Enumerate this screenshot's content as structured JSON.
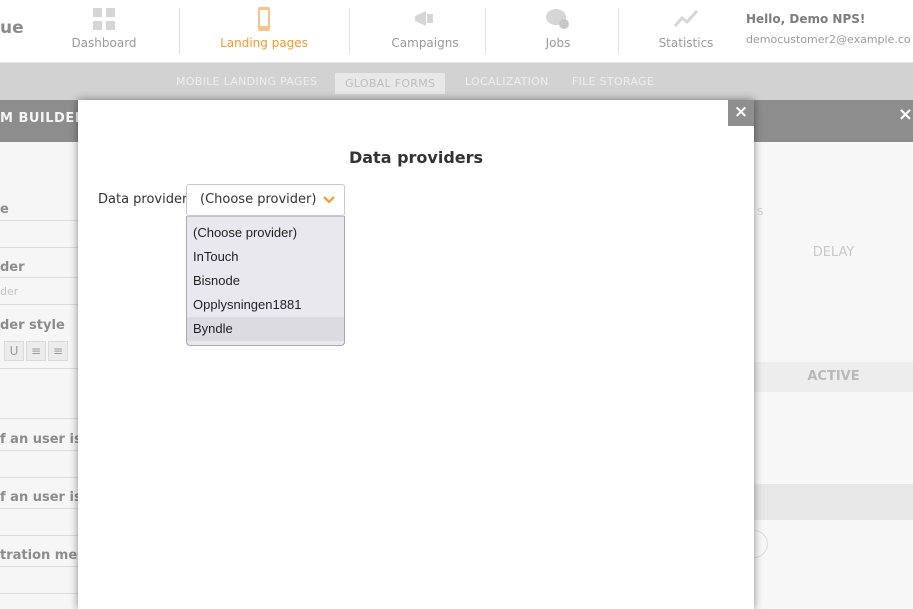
{
  "app": {
    "brand_fragment": "ue",
    "nav": [
      {
        "label": "Dashboard",
        "icon": "grid-icon"
      },
      {
        "label": "Landing pages",
        "icon": "mobile-icon",
        "active": true
      },
      {
        "label": "Campaigns",
        "icon": "megaphone-icon"
      },
      {
        "label": "Jobs",
        "icon": "chat-gear-icon"
      },
      {
        "label": "Statistics",
        "icon": "line-chart-icon"
      }
    ],
    "user": {
      "greeting": "Hello, Demo NPS!",
      "email": "democustomer2@example.co"
    },
    "subtabs": [
      "MOBILE LANDING PAGES",
      "GLOBAL FORMS",
      "LOCALIZATION",
      "FILE STORAGE"
    ],
    "selected_subtab": "GLOBAL FORMS",
    "builder_title": "M BUILDER",
    "builder_close": "×"
  },
  "left_panel": {
    "fields": [
      "e",
      "der",
      "der style",
      "f an user is c",
      "f an user is u",
      "tration mess"
    ],
    "placeholder": "der",
    "format_buttons": [
      "U",
      "≡",
      "≡"
    ]
  },
  "right_panel": {
    "mark": "S",
    "delay_header": "DELAY",
    "active_header": "ACTIVE"
  },
  "modal": {
    "title": "Data providers",
    "close": "×",
    "label": "Data provider:",
    "selected": "(Choose provider)",
    "options": [
      "(Choose provider)",
      "InTouch",
      "Bisnode",
      "Opplysningen1881",
      "Byndle"
    ],
    "highlighted_index": 4,
    "accent_color": "#f19a2b"
  }
}
